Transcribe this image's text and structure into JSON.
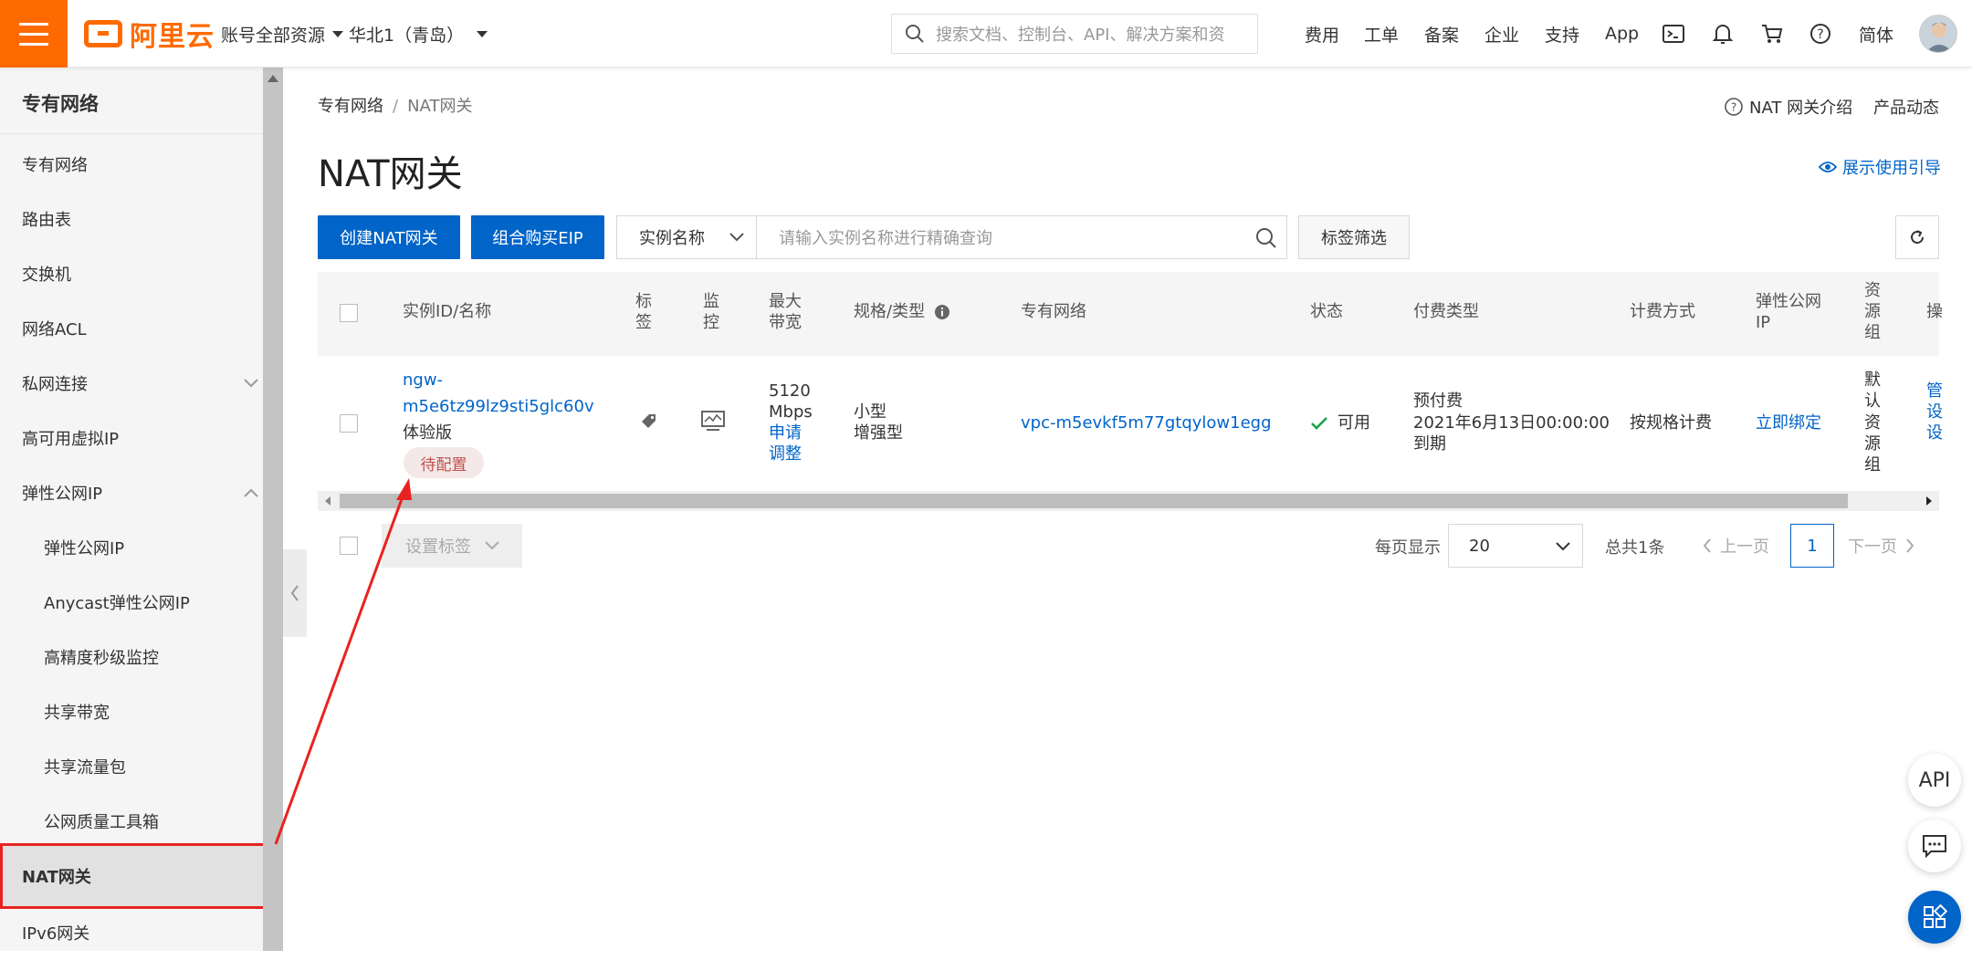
{
  "topbar": {
    "logo_text": "阿里云",
    "account_scope": "账号全部资源",
    "region": "华北1（青岛）",
    "search_placeholder": "搜索文档、控制台、API、解决方案和资",
    "links": [
      "费用",
      "工单",
      "备案",
      "企业",
      "支持",
      "App"
    ],
    "icons": [
      "terminal-icon",
      "bell-icon",
      "cart-icon",
      "help-icon"
    ],
    "language": "简体"
  },
  "sidebar": {
    "title": "专有网络",
    "items": [
      {
        "label": "专有网络"
      },
      {
        "label": "路由表"
      },
      {
        "label": "交换机"
      },
      {
        "label": "网络ACL"
      },
      {
        "label": "私网连接"
      },
      {
        "label": "高可用虚拟IP"
      },
      {
        "label": "弹性公网IP"
      },
      {
        "label": "弹性公网IP"
      },
      {
        "label": "Anycast弹性公网IP"
      },
      {
        "label": "高精度秒级监控"
      },
      {
        "label": "共享带宽"
      },
      {
        "label": "共享流量包"
      },
      {
        "label": "公网质量工具箱"
      },
      {
        "label": "NAT网关"
      },
      {
        "label": "IPv6网关"
      }
    ]
  },
  "breadcrumb": {
    "parent": "专有网络",
    "separator": "/",
    "current": "NAT网关"
  },
  "page_title": "NAT网关",
  "header_links": {
    "intro": "NAT 网关介绍",
    "news": "产品动态",
    "guide": "展示使用引导"
  },
  "toolbar": {
    "create_label": "创建NAT网关",
    "buy_eip_label": "组合购买EIP",
    "filter_field": "实例名称",
    "search_placeholder": "请输入实例名称进行精确查询",
    "tag_filter_label": "标签筛选"
  },
  "table": {
    "headers": {
      "id_name": "实例ID/名称",
      "tag_1": "标",
      "tag_2": "签",
      "monitor_1": "监",
      "monitor_2": "控",
      "bw_1": "最大",
      "bw_2": "带宽",
      "spec": "规格/类型",
      "vpc": "专有网络",
      "status": "状态",
      "pay_type": "付费类型",
      "billing": "计费方式",
      "eip_1": "弹性公网",
      "eip_2": "IP",
      "rg_1": "资",
      "rg_2": "源",
      "rg_3": "组",
      "op": "操"
    },
    "row": {
      "id_line1": "ngw-",
      "id_line2": "m5e6tz99lz9sti5glc60v",
      "name": "体验版",
      "badge": "待配置",
      "bandwidth_1": "5120",
      "bandwidth_2": "Mbps",
      "adjust_1": "申请",
      "adjust_2": "调整",
      "spec_1": "小型",
      "spec_2": "增强型",
      "vpc": "vpc-m5evkf5m77gtqylow1egg",
      "status": "可用",
      "pay_1": "预付费",
      "pay_2": "2021年6月13日00:00:00",
      "pay_3": "到期",
      "billing": "按规格计费",
      "eip_action": "立即绑定",
      "rg_1": "默",
      "rg_2": "认",
      "rg_3": "资",
      "rg_4": "源",
      "rg_5": "组",
      "op_1": "管",
      "op_2": "设",
      "op_3": "设"
    }
  },
  "footer": {
    "set_tag_label": "设置标签",
    "per_page_label": "每页显示",
    "per_page_value": "20",
    "total_label": "总共1条",
    "prev_label": "上一页",
    "current_page": "1",
    "next_label": "下一页"
  },
  "floating": {
    "api_label": "API"
  },
  "colors": {
    "brand": "#ff6a00",
    "primary": "#0064c8",
    "annotation": "#e8231f"
  }
}
